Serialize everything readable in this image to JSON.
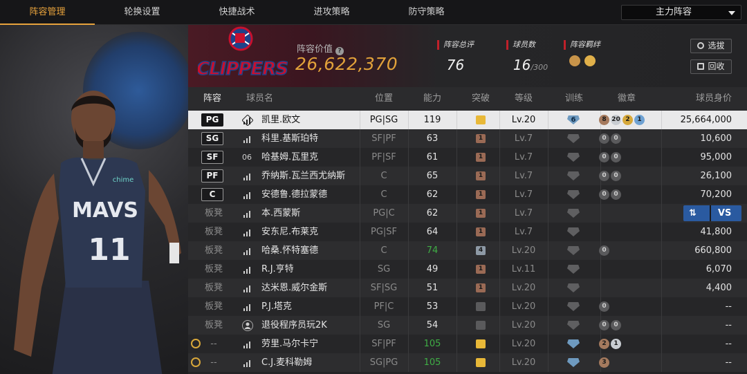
{
  "nav": {
    "tabs": [
      "阵容管理",
      "轮换设置",
      "快捷战术",
      "进攻策略",
      "防守策略"
    ],
    "active_tab": 0,
    "lineup_select": "主力阵容"
  },
  "header": {
    "club_logo_text": "CLIPPERS",
    "value_label": "阵容价值",
    "value": "26,622,370",
    "stats": {
      "overall_label": "阵容总评",
      "overall_value": "76",
      "players_label": "球员数",
      "players_value": "16",
      "players_max": "/300",
      "synergy_label": "阵容羁绊"
    },
    "buttons": {
      "scout": "选拔",
      "recycle": "回收"
    }
  },
  "table": {
    "headers": [
      "阵容",
      "球员名",
      "位置",
      "能力",
      "突破",
      "等级",
      "训练",
      "徽章",
      "球员身价"
    ],
    "rows": [
      {
        "slot": "PG",
        "starter": true,
        "name": "凯里.欧文",
        "pos": "PG|SG",
        "ovr": "119",
        "ovr_color": "normal",
        "breakthrough": "crown",
        "level": "Lv.20",
        "training": "6",
        "badges": [
          {
            "c": "bronze",
            "t": "8"
          },
          {
            "c": "silver",
            "t": "20"
          },
          {
            "c": "gold",
            "t": "2"
          },
          {
            "c": "blue",
            "t": "1"
          }
        ],
        "value": "25,664,000"
      },
      {
        "slot": "SG",
        "starter": true,
        "name": "科里.基斯珀特",
        "pos": "SF|PF",
        "ovr": "63",
        "ovr_color": "normal",
        "breakthrough": "1",
        "level": "Lv.7",
        "training": "empty",
        "badges": [
          {
            "c": "gray",
            "t": "0"
          },
          {
            "c": "gray",
            "t": "0"
          }
        ],
        "value": "10,600"
      },
      {
        "slot": "SF",
        "starter": true,
        "name": "哈基姆.瓦里克",
        "pos": "PF|SF",
        "ovr": "61",
        "ovr_color": "normal",
        "breakthrough": "1",
        "level": "Lv.7",
        "training": "empty",
        "badges": [
          {
            "c": "gray",
            "t": "0"
          },
          {
            "c": "gray",
            "t": "0"
          }
        ],
        "value": "95,000",
        "jersey": "06"
      },
      {
        "slot": "PF",
        "starter": true,
        "name": "乔纳斯.瓦兰西尤纳斯",
        "pos": "C",
        "ovr": "65",
        "ovr_color": "normal",
        "breakthrough": "1",
        "level": "Lv.7",
        "training": "empty",
        "badges": [
          {
            "c": "gray",
            "t": "0"
          },
          {
            "c": "gray",
            "t": "0"
          }
        ],
        "value": "26,100"
      },
      {
        "slot": "C",
        "starter": true,
        "name": "安德鲁.德拉蒙德",
        "pos": "C",
        "ovr": "62",
        "ovr_color": "normal",
        "breakthrough": "1",
        "level": "Lv.7",
        "training": "empty",
        "badges": [
          {
            "c": "gray",
            "t": "0"
          },
          {
            "c": "gray",
            "t": "0"
          }
        ],
        "value": "70,200"
      },
      {
        "slot": "板凳",
        "starter": false,
        "name": "本.西蒙斯",
        "pos": "PG|C",
        "ovr": "62",
        "ovr_color": "normal",
        "breakthrough": "1",
        "level": "Lv.7",
        "training": "empty",
        "badges": [],
        "value": "",
        "swap_vs": true
      },
      {
        "slot": "板凳",
        "starter": false,
        "name": "安东尼.布莱克",
        "pos": "PG|SF",
        "ovr": "64",
        "ovr_color": "normal",
        "breakthrough": "1",
        "level": "Lv.7",
        "training": "empty",
        "badges": [],
        "value": "41,800"
      },
      {
        "slot": "板凳",
        "starter": false,
        "name": "哈桑.怀特塞德",
        "pos": "C",
        "ovr": "74",
        "ovr_color": "green",
        "breakthrough": "4",
        "level": "Lv.20",
        "training": "empty",
        "badges": [
          {
            "c": "gray",
            "t": "0"
          }
        ],
        "value": "660,800"
      },
      {
        "slot": "板凳",
        "starter": false,
        "name": "R.J.亨特",
        "pos": "SG",
        "ovr": "49",
        "ovr_color": "normal",
        "breakthrough": "1",
        "level": "Lv.11",
        "training": "empty",
        "badges": [],
        "value": "6,070"
      },
      {
        "slot": "板凳",
        "starter": false,
        "name": "达米恩.威尔金斯",
        "pos": "SF|SG",
        "ovr": "51",
        "ovr_color": "normal",
        "breakthrough": "1",
        "level": "Lv.20",
        "training": "empty",
        "badges": [],
        "value": "4,400"
      },
      {
        "slot": "板凳",
        "starter": false,
        "name": "P.J.塔克",
        "pos": "PF|C",
        "ovr": "53",
        "ovr_color": "normal",
        "breakthrough": "empty",
        "level": "Lv.20",
        "training": "empty",
        "badges": [
          {
            "c": "gray",
            "t": "0"
          }
        ],
        "value": "--"
      },
      {
        "slot": "板凳",
        "starter": false,
        "name": "退役程序员玩2K",
        "pos": "SG",
        "ovr": "54",
        "ovr_color": "normal",
        "breakthrough": "empty",
        "level": "Lv.20",
        "training": "empty",
        "badges": [
          {
            "c": "gray",
            "t": "0"
          },
          {
            "c": "gray",
            "t": "0"
          }
        ],
        "value": "--",
        "user_icon": true
      },
      {
        "slot": "--",
        "starter": false,
        "alarm": true,
        "name": "劳里.马尔卡宁",
        "pos": "SF|PF",
        "ovr": "105",
        "ovr_color": "green",
        "breakthrough": "crown",
        "level": "Lv.20",
        "training": "blue",
        "badges": [
          {
            "c": "bronze",
            "t": "2"
          },
          {
            "c": "silver",
            "t": "1"
          }
        ],
        "value": "--"
      },
      {
        "slot": "--",
        "starter": false,
        "alarm": true,
        "name": "C.J.麦科勒姆",
        "pos": "SG|PG",
        "ovr": "105",
        "ovr_color": "green",
        "breakthrough": "crown",
        "level": "Lv.20",
        "training": "blue",
        "badges": [
          {
            "c": "bronze",
            "t": "3"
          }
        ],
        "value": "--"
      }
    ]
  },
  "player_panel": {
    "jersey_text": "MAVS",
    "jersey_number": "11",
    "sponsor": "chime"
  }
}
